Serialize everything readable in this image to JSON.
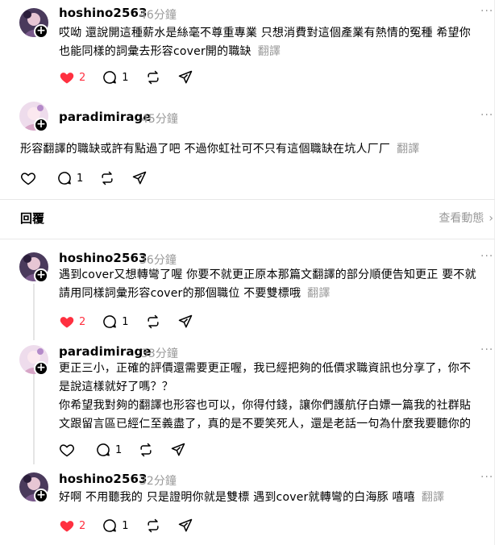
{
  "replies_bar": {
    "title": "回覆",
    "view_activity": "查看動態"
  },
  "posts": [
    {
      "username": "hoshino2563",
      "time": "46分鐘",
      "lines": [
        "哎呦 還說開這種薪水是絲毫不尊重專業 只想消費對這個產業有熱情的冤種 希望你",
        "也能同樣的詞彙去形容cover開的職缺"
      ],
      "translate": "翻譯",
      "likes": "2",
      "comments": "1",
      "liked": true
    },
    {
      "username": "paradimirage",
      "time": "45分鐘",
      "lines": [
        "形容翻譯的職缺或許有點過了吧 不過你虹社可不只有這個職缺在坑人厂厂"
      ],
      "translate": "翻譯",
      "likes": "",
      "comments": "1",
      "liked": false
    },
    {
      "username": "hoshino2563",
      "time": "36分鐘",
      "lines": [
        "遇到cover又想轉彎了喔 你要不就更正原本那篇文翻譯的部分順便告知更正 要不就",
        "請用同樣詞彙形容cover的那個職位 不要雙標哦"
      ],
      "translate": "翻譯",
      "likes": "2",
      "comments": "1",
      "liked": true
    },
    {
      "username": "paradimirage",
      "time": "33分鐘",
      "lines": [
        "更正三小，正確的評價還需要更正喔，我已經把夠的低價求職資訊也分享了，你不",
        "是說這樣就好了嗎？？",
        "你希望我對夠的翻譯也形容也可以，你得付錢，讓你們護航仔白嫖一篇我的社群貼",
        "文跟留言區已經仁至義盡了，真的是不要笑死人，還是老話一句為什麼我要聽你的"
      ],
      "translate": "",
      "likes": "",
      "comments": "1",
      "liked": false
    },
    {
      "username": "hoshino2563",
      "time": "32分鐘",
      "lines": [
        "好啊 不用聽我的 只是證明你就是雙標 遇到cover就轉彎的白海豚 嘻嘻"
      ],
      "translate": "翻譯",
      "likes": "2",
      "comments": "1",
      "liked": true
    }
  ],
  "icons": {
    "like": "heart-icon",
    "comment": "comment-icon",
    "repost": "repost-icon",
    "share": "share-icon",
    "more": "more-icon"
  },
  "colors": {
    "like": "#ff3040",
    "muted": "#999999"
  }
}
